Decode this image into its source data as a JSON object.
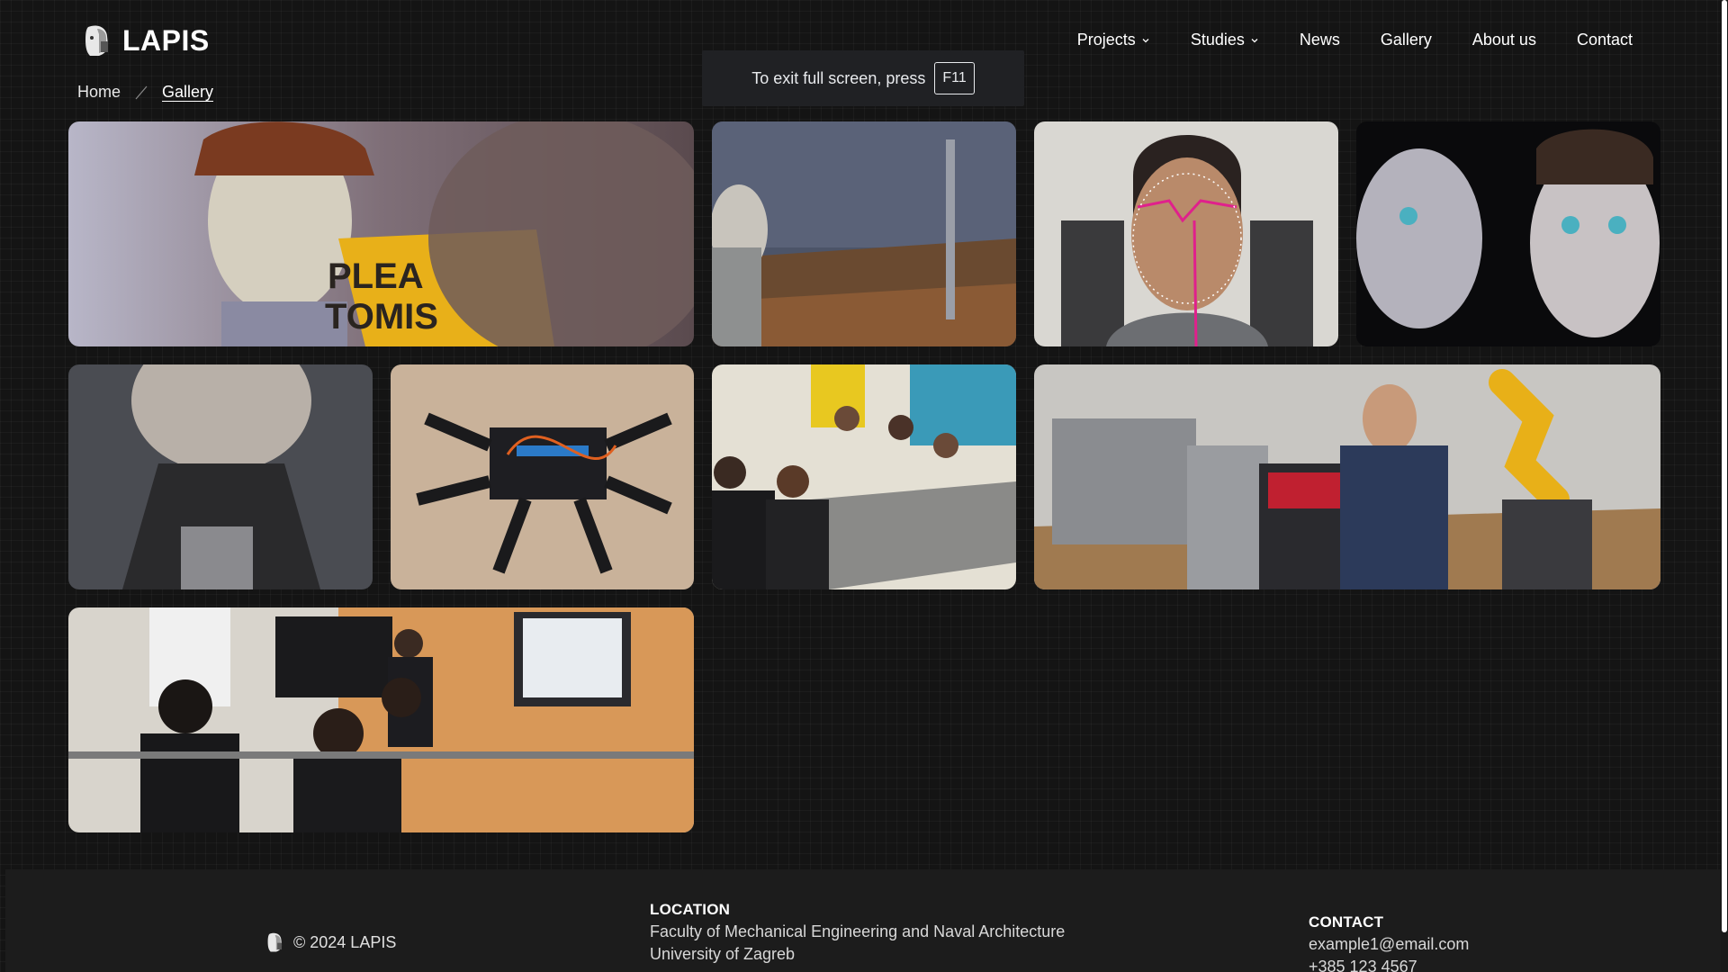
{
  "brand": {
    "name": "LAPIS",
    "logo_icon": "mask-head-icon"
  },
  "nav": {
    "items": [
      {
        "label": "Projects",
        "has_dropdown": true
      },
      {
        "label": "Studies",
        "has_dropdown": true
      },
      {
        "label": "News",
        "has_dropdown": false
      },
      {
        "label": "Gallery",
        "has_dropdown": false
      },
      {
        "label": "About us",
        "has_dropdown": false
      },
      {
        "label": "Contact",
        "has_dropdown": false
      }
    ]
  },
  "breadcrumb": {
    "home": "Home",
    "current": "Gallery"
  },
  "fullscreen_toast": {
    "text": "To exit full screen, press",
    "key": "F11"
  },
  "gallery": {
    "images": [
      {
        "name": "robot-head-with-sign",
        "sign_text_1": "PLEA",
        "sign_text_2": "TOMIS"
      },
      {
        "name": "robot-head-in-lab"
      },
      {
        "name": "face-landmark-tracking"
      },
      {
        "name": "projected-faces-dark"
      },
      {
        "name": "robot-face-closeup"
      },
      {
        "name": "hexapod-robot"
      },
      {
        "name": "students-in-classroom"
      },
      {
        "name": "robotic-arm-demo"
      },
      {
        "name": "lecture-presentation"
      }
    ]
  },
  "footer": {
    "copyright": "© 2024 LAPIS",
    "location": {
      "heading": "LOCATION",
      "line1": "Faculty of Mechanical Engineering and Naval Architecture",
      "line2": "University of Zagreb"
    },
    "contact": {
      "heading": "CONTACT",
      "email": "example1@email.com",
      "phone": "+385 123 4567"
    }
  },
  "colors": {
    "background": "#141414",
    "footer": "#1c1c1c",
    "text": "#ffffff",
    "accent_magenta": "#e0208c"
  }
}
